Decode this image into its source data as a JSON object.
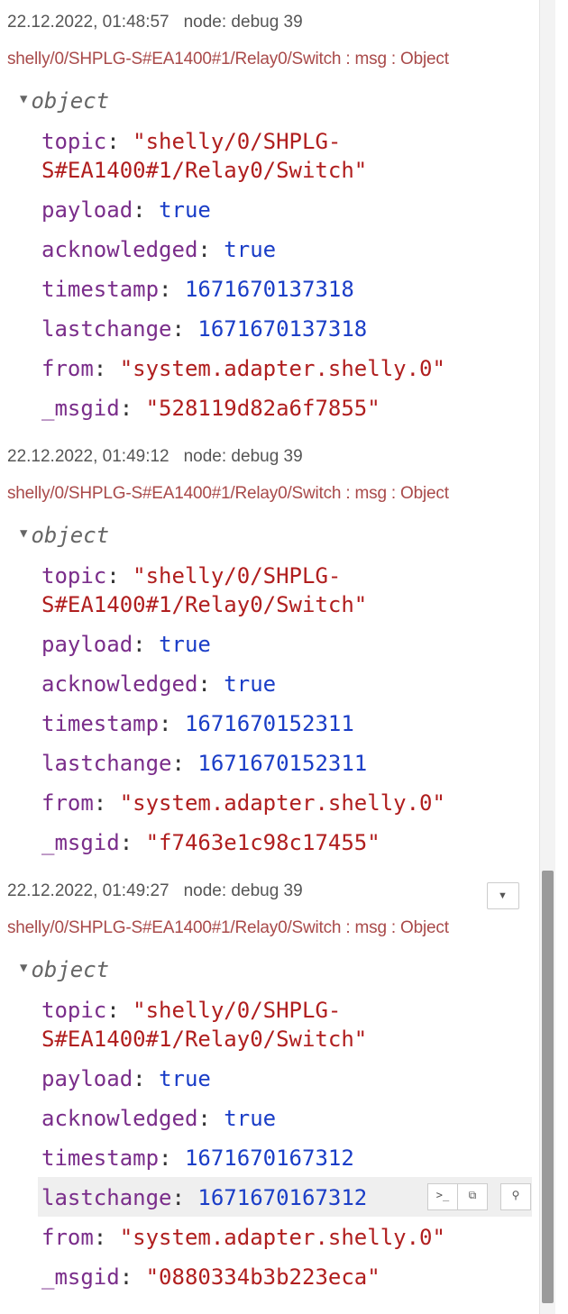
{
  "messages": [
    {
      "time": "22.12.2022, 01:48:57",
      "node": "node: debug 39",
      "topic_line": "shelly/0/SHPLG-S#EA1400#1/Relay0/Switch : msg : Object",
      "object_label": "object",
      "topic_key": "topic",
      "topic_line1": "\"shelly/0/SHPLG-",
      "topic_line2": "S#EA1400#1/Relay0/Switch\"",
      "payload_key": "payload",
      "payload": "true",
      "acknowledged_key": "acknowledged",
      "acknowledged": "true",
      "timestamp_key": "timestamp",
      "timestamp": "1671670137318",
      "lastchange_key": "lastchange",
      "lastchange": "1671670137318",
      "from_key": "from",
      "from": "\"system.adapter.shelly.0\"",
      "msgid_key": "_msgid",
      "msgid": "\"528119d82a6f7855\""
    },
    {
      "time": "22.12.2022, 01:49:12",
      "node": "node: debug 39",
      "topic_line": "shelly/0/SHPLG-S#EA1400#1/Relay0/Switch : msg : Object",
      "object_label": "object",
      "topic_key": "topic",
      "topic_line1": "\"shelly/0/SHPLG-",
      "topic_line2": "S#EA1400#1/Relay0/Switch\"",
      "payload_key": "payload",
      "payload": "true",
      "acknowledged_key": "acknowledged",
      "acknowledged": "true",
      "timestamp_key": "timestamp",
      "timestamp": "1671670152311",
      "lastchange_key": "lastchange",
      "lastchange": "1671670152311",
      "from_key": "from",
      "from": "\"system.adapter.shelly.0\"",
      "msgid_key": "_msgid",
      "msgid": "\"f7463e1c98c17455\""
    },
    {
      "time": "22.12.2022, 01:49:27",
      "node": "node: debug 39",
      "topic_line": "shelly/0/SHPLG-S#EA1400#1/Relay0/Switch : msg : Object",
      "object_label": "object",
      "topic_key": "topic",
      "topic_line1": "\"shelly/0/SHPLG-",
      "topic_line2": "S#EA1400#1/Relay0/Switch\"",
      "payload_key": "payload",
      "payload": "true",
      "acknowledged_key": "acknowledged",
      "acknowledged": "true",
      "timestamp_key": "timestamp",
      "timestamp": "1671670167312",
      "lastchange_key": "lastchange",
      "lastchange": "1671670167312",
      "from_key": "from",
      "from": "\"system.adapter.shelly.0\"",
      "msgid_key": "_msgid",
      "msgid": "\"0880334b3b223eca\""
    }
  ],
  "icons": {
    "caret": "triangle-down",
    "dropdown": "chevron-down-icon",
    "copy_path": "terminal-icon",
    "copy_value": "clipboard-icon",
    "pin": "pin-icon"
  },
  "colors": {
    "key": "#7a2d8a",
    "string": "#b01e1e",
    "number": "#1a3dc7",
    "topic_line": "#a94a4a"
  }
}
